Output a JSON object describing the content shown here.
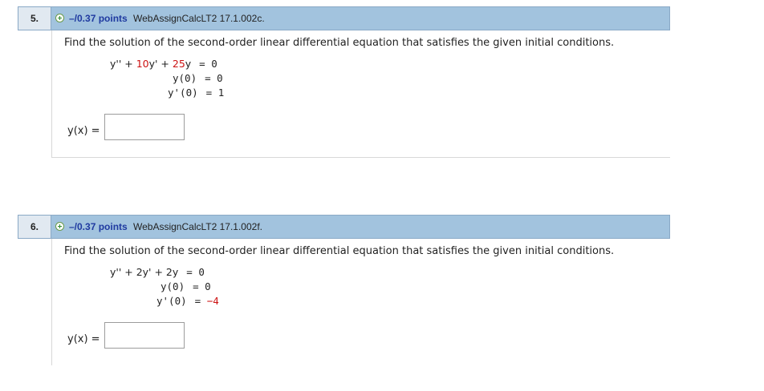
{
  "questions": [
    {
      "number": "5.",
      "points": "–/0.37 points",
      "reference": "WebAssignCalcLT2 17.1.002c.",
      "prompt": "Find the solution of the second-order linear differential equation that satisfies the given initial conditions.",
      "equation": {
        "lhs_prefix": "y'' + ",
        "coef1": "10",
        "mid": "y' + ",
        "coef2": "25",
        "suffix": "y",
        "rhs": "= 0"
      },
      "initial_conditions": [
        {
          "lhs": "y(0)",
          "rhs_prefix": "= ",
          "rhs_value": "0"
        },
        {
          "lhs": "y'(0)",
          "rhs_prefix": "= ",
          "rhs_value": "1"
        }
      ],
      "answer_label": "y(x) =",
      "answer_value": ""
    },
    {
      "number": "6.",
      "points": "–/0.37 points",
      "reference": "WebAssignCalcLT2 17.1.002f.",
      "prompt": "Find the solution of the second-order linear differential equation that satisfies the given initial conditions.",
      "equation": {
        "lhs_prefix": "y'' + ",
        "coef1": "2",
        "mid": "y' + ",
        "coef2": "2",
        "suffix": "y",
        "rhs": "= 0"
      },
      "initial_conditions": [
        {
          "lhs": "y(0)",
          "rhs_prefix": "= ",
          "rhs_value": "0"
        },
        {
          "lhs": "y'(0)",
          "rhs_prefix": "= ",
          "rhs_value": "−4"
        }
      ],
      "answer_label": "y(x) =",
      "answer_value": ""
    }
  ],
  "colors": {
    "header_bg": "#a2c3de",
    "number_bg": "#e1e9f1",
    "points_text": "#1f3aa0",
    "highlight_red": "#cc1111"
  },
  "icons": {
    "expand": "plus-circle-icon"
  }
}
